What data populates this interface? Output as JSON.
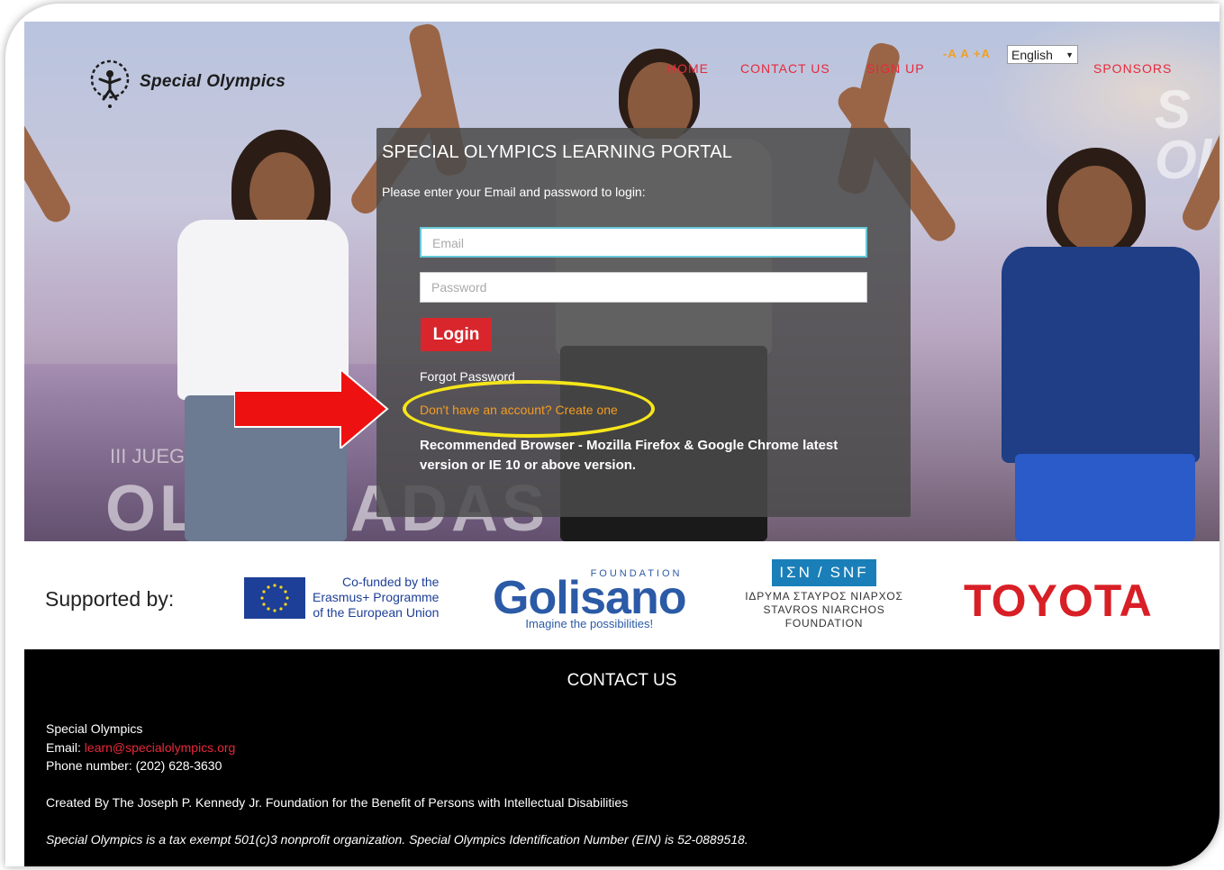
{
  "logo": {
    "text": "Special Olympics"
  },
  "nav": {
    "home": "HOME",
    "contact": "CONTACT US",
    "signup": "SIGN UP",
    "sponsors": "SPONSORS",
    "font_controls": "-A A +A",
    "language": "English"
  },
  "hero": {
    "background_text": "OLIMPIADAS",
    "background_small": "III JUEGOS DAMERIC"
  },
  "login": {
    "title": "SPECIAL OLYMPICS LEARNING PORTAL",
    "subtitle": "Please enter your Email and password to login:",
    "email_placeholder": "Email",
    "password_placeholder": "Password",
    "login_label": "Login",
    "forgot": "Forgot Password",
    "create": "Don't have an account? Create one",
    "recommend": "Recommended Browser - Mozilla Firefox & Google Chrome latest version or IE 10 or above version."
  },
  "sponsors": {
    "label": "Supported by:",
    "eu_text": [
      "Co-funded by the",
      "Erasmus+ Programme",
      "of the European Union"
    ],
    "golisano_foundation": "FOUNDATION",
    "golisano_name": "Golisano",
    "golisano_tag": "Imagine the possibilities!",
    "snf_left": "ΙΣΝ",
    "snf_right": "SNF",
    "snf_lines": [
      "ΙΔΡΥΜΑ ΣΤΑΥΡΟΣ ΝΙΑΡΧΟΣ",
      "STAVROS NIARCHOS",
      "FOUNDATION"
    ],
    "toyota": "TOYOTA"
  },
  "footer": {
    "title": "CONTACT US",
    "org": "Special Olympics",
    "email_label": "Email:",
    "email": "learn@specialolympics.org",
    "phone": "Phone number: (202) 628-3630",
    "created_by": "Created By The Joseph P. Kennedy Jr. Foundation for the Benefit of Persons with Intellectual Disabilities",
    "tax": "Special Olympics is a tax exempt 501(c)3 nonprofit organization. Special Olympics Identification Number (EIN) is 52-0889518."
  },
  "colors": {
    "accent_red": "#e8283a",
    "login_button": "#d8262c",
    "link_orange": "#f39c22",
    "highlight_yellow": "#f6e61a",
    "arrow_red": "#ee1111"
  }
}
